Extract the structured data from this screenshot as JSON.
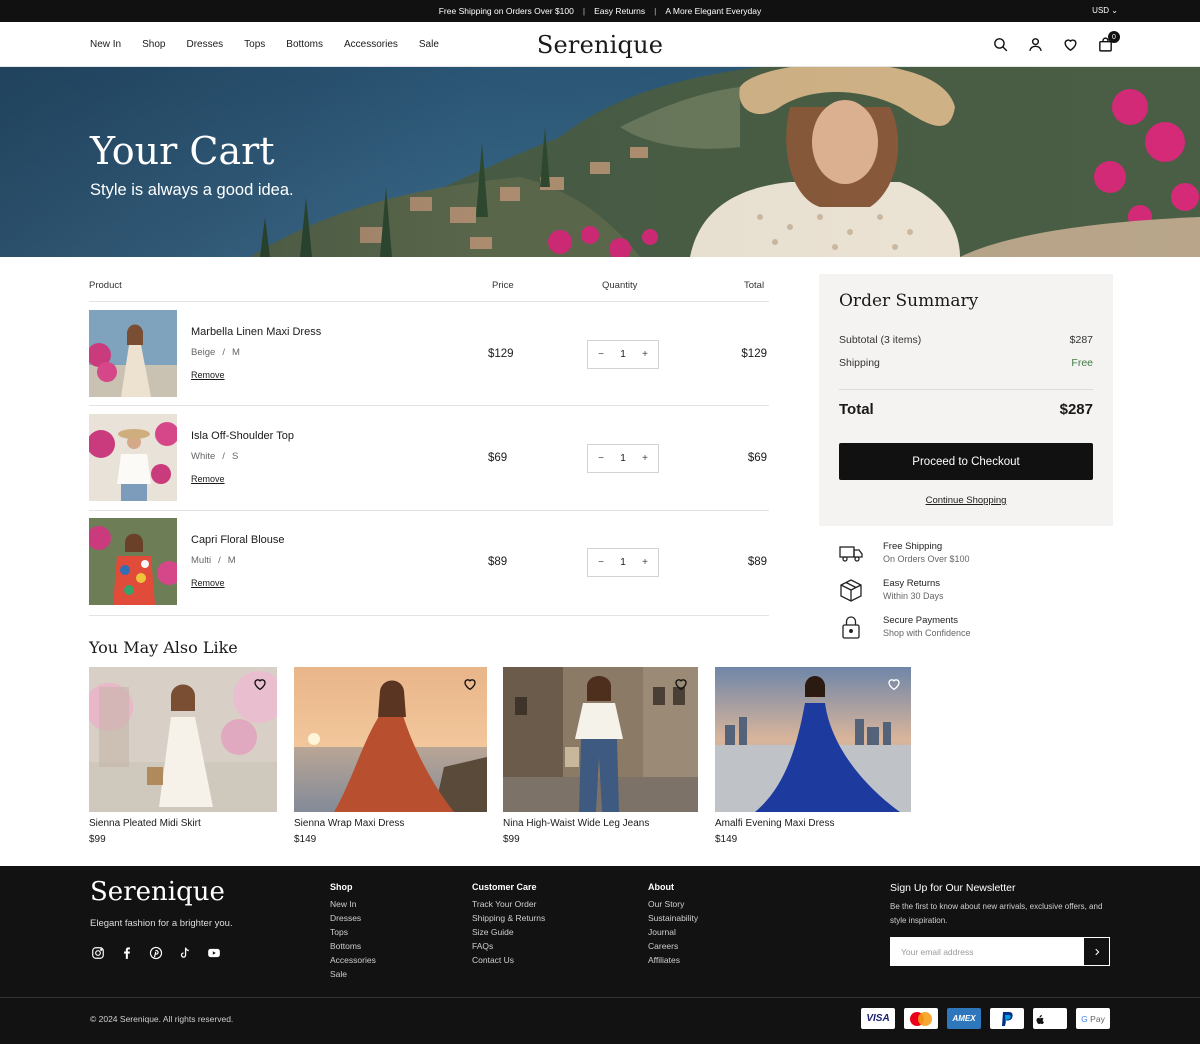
{
  "announcement": {
    "items": [
      "Free Shipping on Orders Over $100",
      "Easy Returns",
      "A More Elegant Everyday"
    ],
    "currency": "USD"
  },
  "header": {
    "nav": [
      "New In",
      "Shop",
      "Dresses",
      "Tops",
      "Bottoms",
      "Accessories",
      "Sale"
    ],
    "logo": "Serenique",
    "cart_count": "0",
    "icons": [
      "search-icon",
      "account-icon",
      "wishlist-icon",
      "bag-icon"
    ]
  },
  "hero": {
    "title": "Your Cart",
    "subtitle": "Style is always a good idea."
  },
  "cart": {
    "columns": [
      "Product",
      "Price",
      "Quantity",
      "Total"
    ],
    "remove_label": "Remove",
    "items": [
      {
        "name": "Marbella Linen Maxi Dress",
        "color": "Beige",
        "size": "M",
        "price": "$129",
        "qty": "1",
        "total": "$129"
      },
      {
        "name": "Isla Off-Shoulder Top",
        "color": "White",
        "size": "S",
        "price": "$69",
        "qty": "1",
        "total": "$69"
      },
      {
        "name": "Capri Floral Blouse",
        "color": "Multi",
        "size": "M",
        "price": "$89",
        "qty": "1",
        "total": "$89"
      }
    ]
  },
  "summary": {
    "title": "Order Summary",
    "subtotal_label": "Subtotal (3 items)",
    "subtotal_value": "$287",
    "shipping_label": "Shipping",
    "shipping_value": "Free",
    "total_label": "Total",
    "total_value": "$287",
    "checkout_label": "Proceed to Checkout",
    "continue_label": "Continue Shopping"
  },
  "perks": [
    {
      "title": "Free Shipping",
      "sub": "On Orders Over $100",
      "icon": "truck-icon"
    },
    {
      "title": "Easy Returns",
      "sub": "Within 30 Days",
      "icon": "box-icon"
    },
    {
      "title": "Secure Payments",
      "sub": "Shop with Confidence",
      "icon": "lock-icon"
    }
  ],
  "recommendations": {
    "title": "You May Also Like",
    "items": [
      {
        "name": "Sienna Pleated Midi Skirt",
        "price": "$99"
      },
      {
        "name": "Sienna Wrap Maxi Dress",
        "price": "$149"
      },
      {
        "name": "Nina High-Waist Wide Leg Jeans",
        "price": "$99"
      },
      {
        "name": "Amalfi Evening Maxi Dress",
        "price": "$149"
      }
    ]
  },
  "footer": {
    "logo": "Serenique",
    "tagline": "Elegant fashion for a brighter you.",
    "social": [
      "instagram-icon",
      "facebook-icon",
      "pinterest-icon",
      "tiktok-icon",
      "youtube-icon"
    ],
    "columns": [
      {
        "heading": "Shop",
        "links": [
          "New In",
          "Dresses",
          "Tops",
          "Bottoms",
          "Accessories",
          "Sale"
        ]
      },
      {
        "heading": "Customer Care",
        "links": [
          "Track Your Order",
          "Shipping & Returns",
          "Size Guide",
          "FAQs",
          "Contact Us"
        ]
      },
      {
        "heading": "About",
        "links": [
          "Our Story",
          "Sustainability",
          "Journal",
          "Careers",
          "Affiliates"
        ]
      }
    ],
    "newsletter": {
      "title": "Sign Up for Our Newsletter",
      "text": "Be the first to know about new arrivals, exclusive offers, and style inspiration.",
      "placeholder": "Your email address"
    },
    "copyright": "© 2024 Serenique. All rights reserved.",
    "payments": [
      "VISA",
      "Mastercard",
      "AMEX",
      "PayPal",
      "Apple Pay",
      "G Pay"
    ]
  },
  "colors": {
    "dark": "#111111",
    "summary_bg": "#f4f3f1",
    "free_green": "#3d7a45",
    "border": "#e3e3e3"
  }
}
